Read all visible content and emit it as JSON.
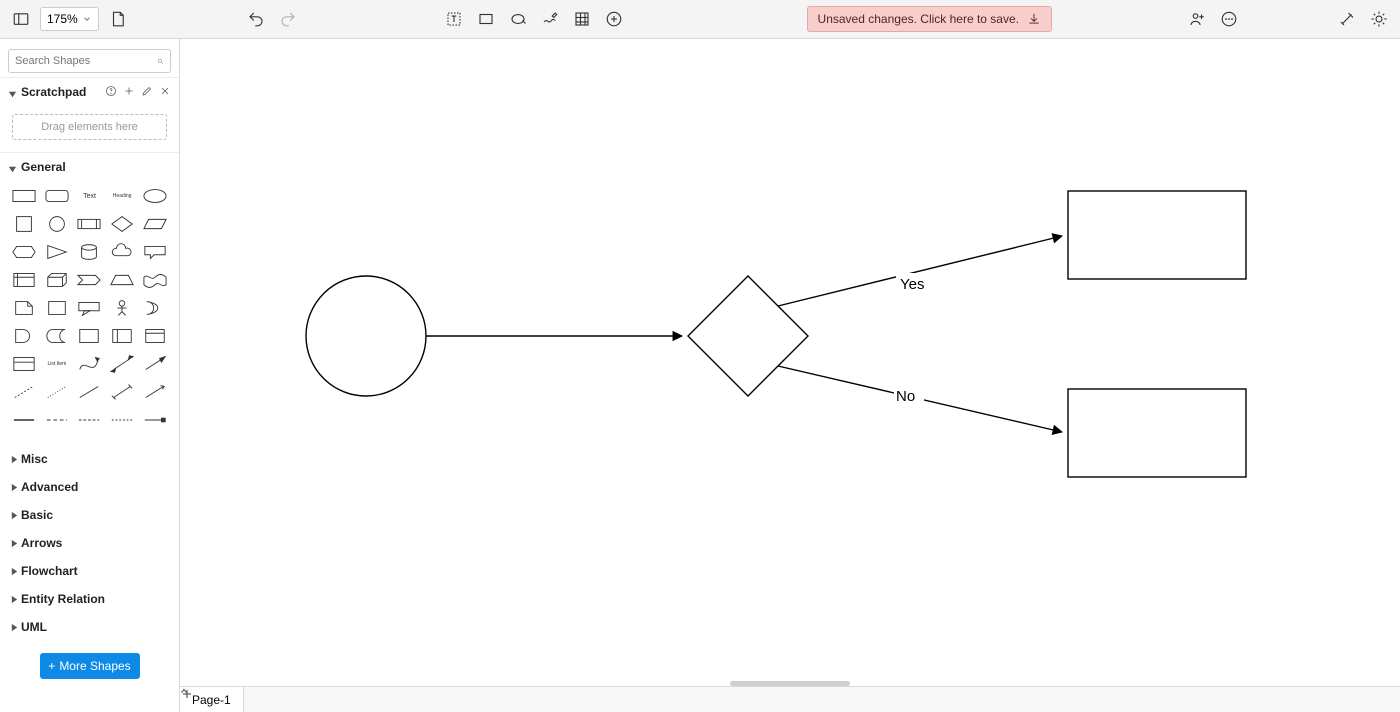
{
  "toolbar": {
    "zoom": "175%",
    "save_banner": "Unsaved changes. Click here to save."
  },
  "sidebar": {
    "search_placeholder": "Search Shapes",
    "scratchpad": {
      "title": "Scratchpad",
      "drop_hint": "Drag elements here"
    },
    "general_title": "General",
    "shapes": {
      "text_label": "Text",
      "heading_label": "Heading",
      "list_item_label": "List Item"
    },
    "collapsed": [
      "Misc",
      "Advanced",
      "Basic",
      "Arrows",
      "Flowchart",
      "Entity Relation",
      "UML"
    ],
    "more_shapes": "More Shapes"
  },
  "canvas": {
    "labels": {
      "yes": "Yes",
      "no": "No"
    }
  },
  "pages": {
    "page1": "Page-1"
  }
}
